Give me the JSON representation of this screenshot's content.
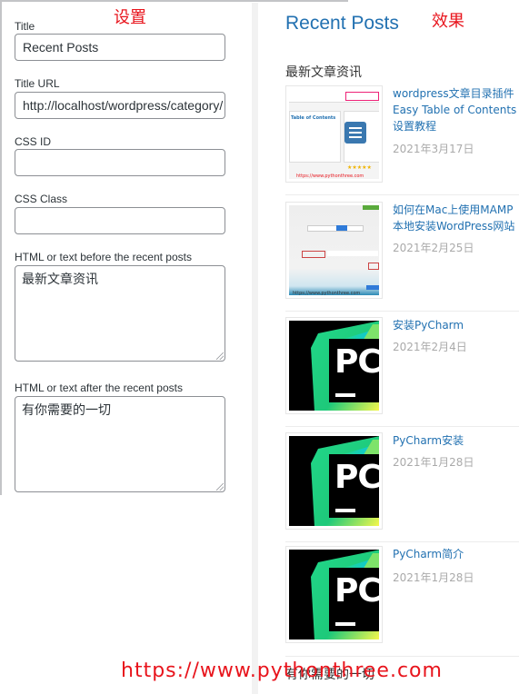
{
  "annotations": {
    "settings_label": "设置",
    "result_label": "效果",
    "watermark": "https://www.pythonthree.com"
  },
  "settings": {
    "title": {
      "label": "Title",
      "value": "Recent Posts"
    },
    "title_url": {
      "label": "Title URL",
      "value": "http://localhost/wordpress/category/"
    },
    "css_id": {
      "label": "CSS ID",
      "value": ""
    },
    "css_class": {
      "label": "CSS Class",
      "value": ""
    },
    "before": {
      "label": "HTML or text before the recent posts",
      "value": "最新文章资讯"
    },
    "after": {
      "label": "HTML or text after the recent posts",
      "value": "有你需要的一切"
    }
  },
  "preview": {
    "widget_title": "Recent Posts",
    "before_text": "最新文章资讯",
    "after_text": "有你需要的一切",
    "posts": [
      {
        "title": "wordpress文章目录插件Easy Table of Contents设置教程",
        "date": "2021年3月17日",
        "thumb": "easy-toc-screenshot"
      },
      {
        "title": "如何在Mac上使用MAMP本地安装WordPress网站",
        "date": "2021年2月25日",
        "thumb": "mamp-screenshot"
      },
      {
        "title": "安装PyCharm",
        "date": "2021年2月4日",
        "thumb": "pycharm-logo"
      },
      {
        "title": "PyCharm安装",
        "date": "2021年1月28日",
        "thumb": "pycharm-logo"
      },
      {
        "title": "PyCharm简介",
        "date": "2021年1月28日",
        "thumb": "pycharm-logo"
      }
    ],
    "thumb_text": {
      "pc": "PC",
      "toc_heading": "Table of Contents",
      "toc_watermark": "https://www.pythonthree.com",
      "mamp_watermark": "https://www.pythonthree.com"
    }
  },
  "colors": {
    "link": "#2271b1",
    "annotation": "#e8141c",
    "date": "#aaaaaa"
  }
}
